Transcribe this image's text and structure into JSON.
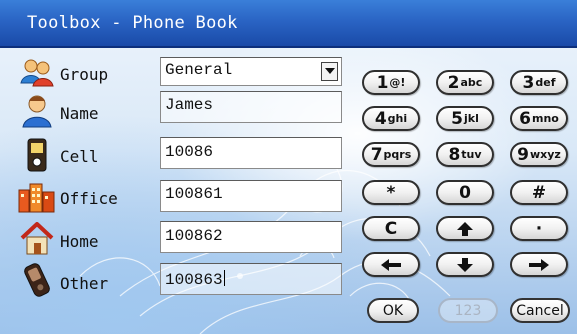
{
  "window": {
    "title": "Toolbox - Phone Book"
  },
  "form": {
    "group": {
      "label": "Group",
      "value": "General"
    },
    "name": {
      "label": "Name",
      "value": "James"
    },
    "cell": {
      "label": "Cell",
      "value": "10086"
    },
    "office": {
      "label": "Office",
      "value": "100861"
    },
    "home": {
      "label": "Home",
      "value": "100862"
    },
    "other": {
      "label": "Other",
      "value": "100863"
    }
  },
  "keypad": {
    "k1": {
      "main": "1",
      "sub": "@!"
    },
    "k2": {
      "main": "2",
      "sub": "abc"
    },
    "k3": {
      "main": "3",
      "sub": "def"
    },
    "k4": {
      "main": "4",
      "sub": "ghi"
    },
    "k5": {
      "main": "5",
      "sub": "jkl"
    },
    "k6": {
      "main": "6",
      "sub": "mno"
    },
    "k7": {
      "main": "7",
      "sub": "pqrs"
    },
    "k8": {
      "main": "8",
      "sub": "tuv"
    },
    "k9": {
      "main": "9",
      "sub": "wxyz"
    },
    "star": "*",
    "zero": "0",
    "hash": "#",
    "clear": "C",
    "dot": "·"
  },
  "buttons": {
    "ok": "OK",
    "mode": "123",
    "cancel": "Cancel"
  },
  "icons": {
    "group": "group-people-icon",
    "name": "person-icon",
    "cell": "mobile-phone-icon",
    "office": "office-building-icon",
    "home": "house-icon",
    "other": "other-phone-icon",
    "up": "arrow-up-icon",
    "down": "arrow-down-icon",
    "left": "arrow-left-icon",
    "right": "arrow-right-icon"
  },
  "colors": {
    "titlebar": "#2a64c4",
    "background": "#d9e8f7",
    "text": "#111111"
  }
}
